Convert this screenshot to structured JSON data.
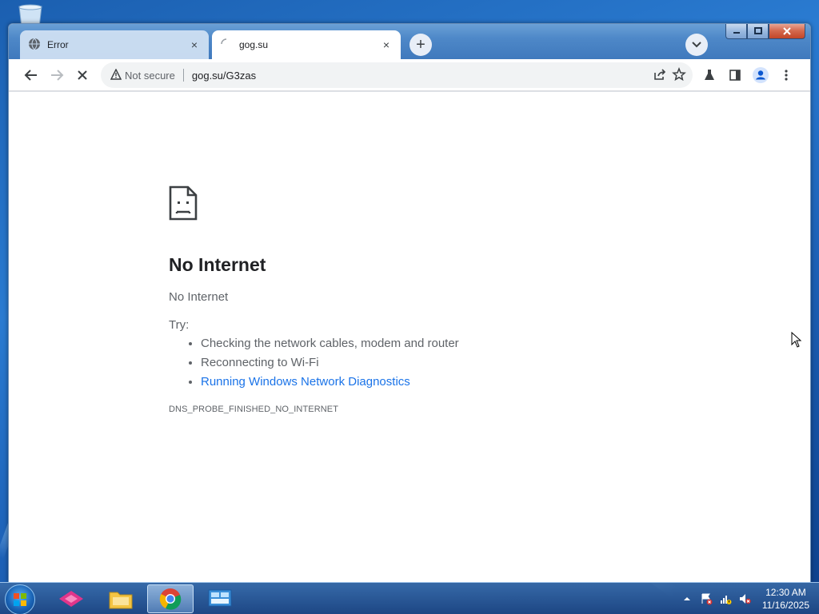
{
  "colors": {
    "accent": "#1a73e8",
    "text_primary": "#202124",
    "text_secondary": "#5f6368",
    "tab_strip": "#dee1e6"
  },
  "browser": {
    "tabs": [
      {
        "title": "Error",
        "icon": "globe-icon",
        "active": false,
        "close": "×"
      },
      {
        "title": "gog.su",
        "icon": "loading-spinner-icon",
        "active": true,
        "close": "×"
      }
    ],
    "new_tab": "+",
    "omnibox": {
      "security_icon": "warning-triangle-icon",
      "security_label": "Not secure",
      "url": "gog.su/G3zas"
    },
    "toolbar_icons": [
      "back-arrow-icon",
      "forward-arrow-icon",
      "stop-loading-icon",
      "share-icon",
      "star-bookmark-icon",
      "labs-flask-icon",
      "side-panel-icon",
      "profile-avatar-icon",
      "more-menu-icon"
    ]
  },
  "page": {
    "icon": "sad-page-icon",
    "heading": "No Internet",
    "subtitle": "No Internet",
    "try_label": "Try:",
    "suggestions": [
      "Checking the network cables, modem and router",
      "Reconnecting to Wi-Fi"
    ],
    "diagnostics_link": "Running Windows Network Diagnostics",
    "error_code": "DNS_PROBE_FINISHED_NO_INTERNET"
  },
  "taskbar": {
    "items": [
      "start-orb-icon",
      "app-icon",
      "file-explorer-icon",
      "chrome-icon",
      "control-panel-icon"
    ],
    "active_item": "chrome-icon",
    "clock": {
      "time": "12:30 AM",
      "date": "11/16/2025"
    },
    "tray_icons": [
      "show-hidden-icons-icon",
      "action-center-icon",
      "network-icon",
      "volume-muted-icon"
    ]
  }
}
